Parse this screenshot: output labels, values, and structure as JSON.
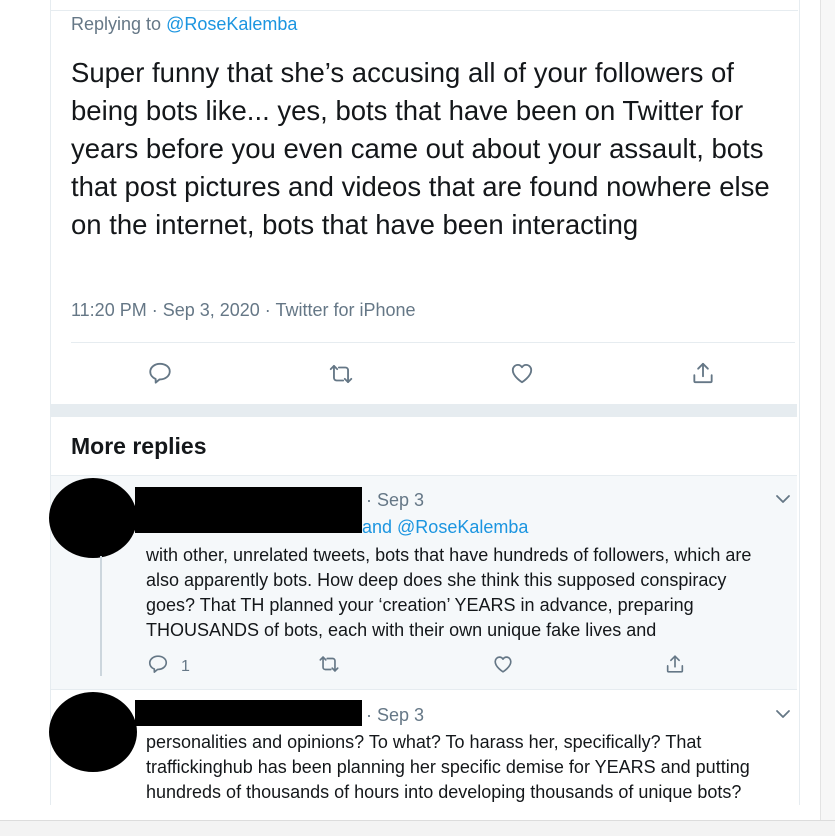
{
  "main_tweet": {
    "replying_prefix": "Replying to ",
    "replying_handle": "@RoseKalemba",
    "text": "Super funny that she’s accusing all of your followers of being bots like... yes, bots that have been on Twitter for years before you even came out about your assault, bots that post pictures and videos that are found nowhere else on the internet, bots that have been interacting",
    "meta": "11:20 PM · Sep 3, 2020 · Twitter for iPhone"
  },
  "actions": {
    "reply_icon": "reply-icon",
    "retweet_icon": "retweet-icon",
    "like_icon": "heart-icon",
    "share_icon": "share-icon"
  },
  "more_replies": {
    "title": "More replies",
    "replies": [
      {
        "date": "· Sep 3",
        "replying_to_tail": "and @RoseKalemba",
        "text": "with other, unrelated tweets, bots that have hundreds of followers, which are\nalso apparently bots. How deep does she think this supposed conspiracy\ngoes? That TH planned your ‘creation’ YEARS in advance, preparing\nTHOUSANDS of bots, each with their own unique fake lives and",
        "reply_count": "1"
      },
      {
        "date": "· Sep 3",
        "text": "personalities and opinions? To what? To harass her, specifically? That\ntraffickinghub has been planning her specific demise for YEARS and putting\nhundreds of thousands of hours into developing thousands of unique bots?"
      }
    ]
  },
  "colors": {
    "link": "#1b95e0",
    "muted": "#657786",
    "text": "#14171a",
    "separator": "#e6ecf0",
    "reply_bg": "#f5f8fa"
  }
}
